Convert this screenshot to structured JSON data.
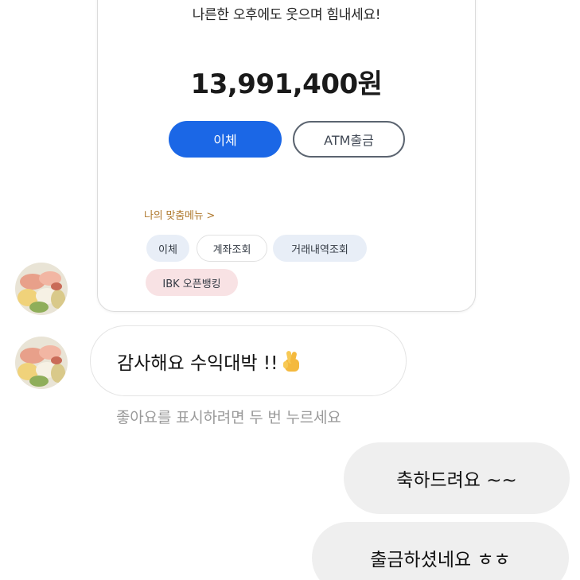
{
  "bank_card": {
    "greeting": "나른한 오후에도 웃으며 힘내세요!",
    "balance": "13,991,400원",
    "transfer_button": "이체",
    "atm_button": "ATM출금",
    "my_menu_label": "나의 맞춤메뉴 >",
    "chips": [
      "이체",
      "계좌조회",
      "거래내역조회",
      "IBK 오픈뱅킹"
    ]
  },
  "messages": {
    "received": {
      "text": "감사해요  수익대박 !!",
      "emoji": "crossed-fingers-emoji"
    },
    "like_hint": "좋아요를 표시하려면 두 번 누르세요",
    "sent": [
      {
        "text": "축하드려요  ~~"
      },
      {
        "text": "출금하셨네요 ㅎㅎ"
      }
    ]
  },
  "colors": {
    "primary_blue": "#1b67e6",
    "sent_bubble": "#efefef",
    "menu_label": "#b07a30",
    "chip_blue": "#e8eef7",
    "chip_pink": "#f8e2e4"
  },
  "icons": {
    "avatar": "food-platter-avatar",
    "emoji": "crossed-fingers-emoji"
  }
}
